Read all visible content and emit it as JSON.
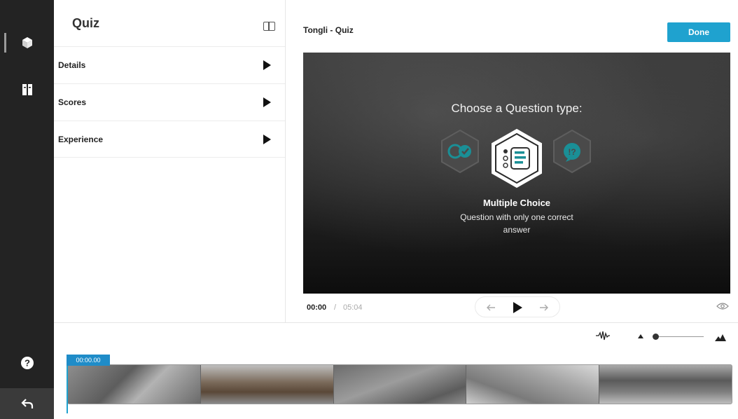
{
  "panel": {
    "title": "Quiz",
    "sections": [
      {
        "label": "Details"
      },
      {
        "label": "Scores"
      },
      {
        "label": "Experience"
      }
    ]
  },
  "header": {
    "activity_title": "Tongli - Quiz",
    "done_label": "Done"
  },
  "stage": {
    "prompt": "Choose a Question type:",
    "selected_type": {
      "title": "Multiple Choice",
      "description": "Question with only one correct answer"
    },
    "options": [
      {
        "icon": "true-false-icon",
        "selected": false
      },
      {
        "icon": "multiple-choice-icon",
        "selected": true
      },
      {
        "icon": "reflection-point-icon",
        "selected": false
      }
    ]
  },
  "player": {
    "current_time": "00:00",
    "separator": "/",
    "total_time": "05:04"
  },
  "timeline": {
    "playhead_time": "00:00.00",
    "zoom_level": 0.1
  },
  "colors": {
    "accent": "#1fa2cf",
    "rail": "#232323",
    "teal": "#1a8f96"
  }
}
